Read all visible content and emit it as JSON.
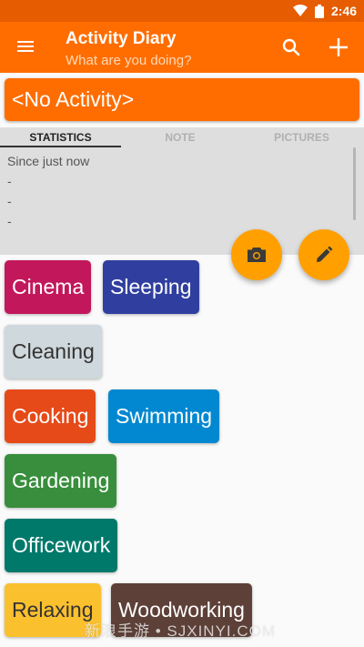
{
  "status_bar": {
    "time": "2:46",
    "icons": [
      "wifi-icon",
      "battery-icon"
    ]
  },
  "app_bar": {
    "title": "Activity Diary",
    "subtitle": "What are you doing?",
    "icons": [
      "menu-icon",
      "search-icon",
      "add-icon"
    ],
    "color": "#ff6d00"
  },
  "current_activity": {
    "label": "<No Activity>"
  },
  "tabs": [
    {
      "label": "STATISTICS",
      "active": true
    },
    {
      "label": "NOTE",
      "active": false
    },
    {
      "label": "PICTURES",
      "active": false
    }
  ],
  "statistics": {
    "lines": [
      "Since just now",
      "-",
      "-",
      "-"
    ]
  },
  "fab": {
    "camera_icon": "camera-icon",
    "edit_icon": "pencil-icon",
    "color": "#ffa000"
  },
  "activities": [
    {
      "label": "Cinema",
      "color": "#c2185b"
    },
    {
      "label": "Sleeping",
      "color": "#303f9f"
    },
    {
      "label": "Cleaning",
      "color": "#cfd8dc"
    },
    {
      "label": "Cooking",
      "color": "#e64a19"
    },
    {
      "label": "Swimming",
      "color": "#0288d1"
    },
    {
      "label": "Gardening",
      "color": "#388e3c"
    },
    {
      "label": "Officework",
      "color": "#00796b"
    },
    {
      "label": "Relaxing",
      "color": "#fbc02d"
    },
    {
      "label": "Woodworking",
      "color": "#5d4037"
    }
  ],
  "watermark": "新浪手游 • SJXINYI.COM"
}
